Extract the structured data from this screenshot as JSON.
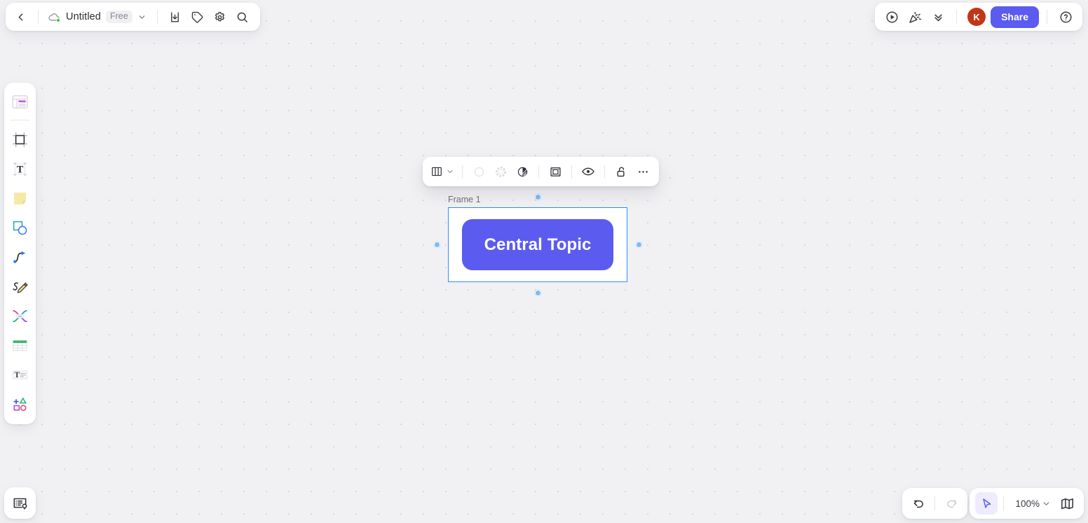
{
  "app": {
    "background_color": "#f1f1f4",
    "accent_color": "#5b5bf0",
    "selection_color": "#2f8ef5"
  },
  "topbar_left": {
    "back_label": "back-arrow",
    "sync_status": "synced",
    "title": "Untitled",
    "plan_badge": "Free",
    "title_chevron": "chevron-down",
    "actions": [
      {
        "name": "export-button",
        "icon": "download-icon",
        "label": "Export"
      },
      {
        "name": "tag-button",
        "icon": "tag-icon",
        "label": "Tag"
      },
      {
        "name": "settings-button",
        "icon": "gear-icon",
        "label": "Settings"
      },
      {
        "name": "search-button",
        "icon": "search-icon",
        "label": "Search"
      }
    ]
  },
  "topbar_right": {
    "actions": [
      {
        "name": "present-button",
        "icon": "play-circle-icon",
        "label": "Present"
      },
      {
        "name": "celebrate-button",
        "icon": "party-popper-icon",
        "label": "Celebrate"
      },
      {
        "name": "collapse-button",
        "icon": "double-chevron-down-icon",
        "label": "Collapse"
      }
    ],
    "avatar_initial": "K",
    "avatar_color": "#c43517",
    "share_label": "Share",
    "help_icon": "question-circle-icon"
  },
  "tool_rail": {
    "items": [
      {
        "name": "sidebar-item-template",
        "icon": "template-icon",
        "label": "Templates"
      },
      {
        "name": "sidebar-item-frame",
        "icon": "frame-icon",
        "label": "Frame"
      },
      {
        "name": "sidebar-item-text",
        "icon": "text-icon",
        "label": "Text"
      },
      {
        "name": "sidebar-item-sticky-note",
        "icon": "sticky-note-icon",
        "label": "Sticky Note"
      },
      {
        "name": "sidebar-item-shape",
        "icon": "shapes-icon",
        "label": "Shape"
      },
      {
        "name": "sidebar-item-connector",
        "icon": "curve-connector-icon",
        "label": "Connector"
      },
      {
        "name": "sidebar-item-pen",
        "icon": "pen-icon",
        "label": "Pen"
      },
      {
        "name": "sidebar-item-mindmap",
        "icon": "mindmap-icon",
        "label": "Mind Map"
      },
      {
        "name": "sidebar-item-table",
        "icon": "table-icon",
        "label": "Table"
      },
      {
        "name": "sidebar-item-textbox",
        "icon": "text-block-icon",
        "label": "Text Block"
      },
      {
        "name": "sidebar-item-more-tools",
        "icon": "more-shapes-icon",
        "label": "More"
      }
    ]
  },
  "notes_button": {
    "name": "notes-panel-button",
    "icon": "notes-idea-icon",
    "label": "Notes"
  },
  "history_bar": {
    "undo": {
      "label": "Undo",
      "icon": "undo-arrow-icon",
      "enabled": true
    },
    "redo": {
      "label": "Redo",
      "icon": "redo-arrow-icon",
      "enabled": false
    }
  },
  "view_bar": {
    "cursor_tool": {
      "label": "Select",
      "icon": "cursor-arrow-icon",
      "active": true
    },
    "zoom_level": "100%",
    "zoom_chevron": "chevron-down",
    "minimap": {
      "label": "Minimap",
      "icon": "map-icon"
    }
  },
  "context_toolbar": {
    "layout": {
      "label": "Layout",
      "icon": "columns-layout-icon"
    },
    "layout_chevron": "chevron-down",
    "fill_color": {
      "label": "Fill color",
      "icon": "circle-outline-icon"
    },
    "border_color": {
      "label": "Border color",
      "icon": "dashed-ring-icon"
    },
    "opacity": {
      "label": "Opacity",
      "icon": "half-filled-circle-icon"
    },
    "fit_frame": {
      "label": "Fit to frame",
      "icon": "fit-frame-icon"
    },
    "visibility": {
      "label": "Show / hide",
      "icon": "eye-icon"
    },
    "lock": {
      "label": "Unlocked",
      "icon": "unlock-icon"
    },
    "more": {
      "label": "More options",
      "icon": "ellipsis-icon"
    }
  },
  "canvas": {
    "frame": {
      "label": "Frame 1",
      "border_color": "#2f8ef5",
      "fill_color": "#ffffff"
    },
    "node": {
      "text": "Central Topic",
      "fill_color": "#5b5bf0",
      "text_color": "#ffffff"
    },
    "handles": [
      "top",
      "right",
      "bottom",
      "left"
    ]
  }
}
